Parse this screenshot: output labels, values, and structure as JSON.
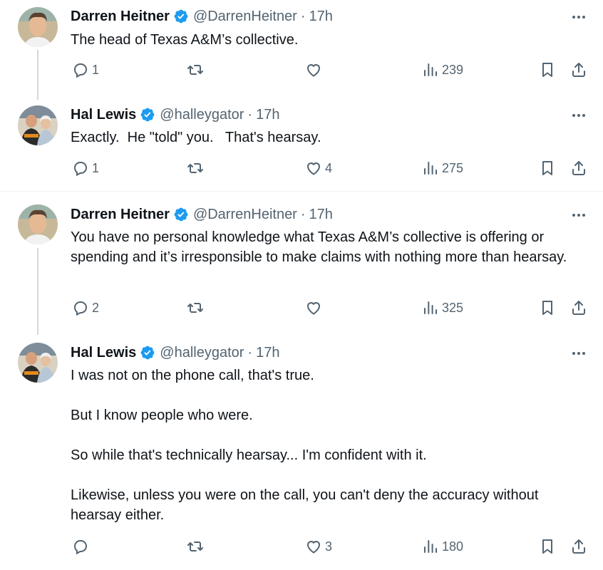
{
  "tweets": [
    {
      "author": "Darren Heitner",
      "handle": "@DarrenHeitner",
      "time": "17h",
      "text": "The head of Texas A&M’s collective.",
      "replies": "1",
      "retweets": "",
      "likes": "",
      "views": "239",
      "avatar": "darren-heitner-avatar"
    },
    {
      "author": "Hal Lewis",
      "handle": "@halleygator",
      "time": "17h",
      "text": "Exactly.  He \"told\" you.   That's hearsay.",
      "replies": "1",
      "retweets": "",
      "likes": "4",
      "views": "275",
      "avatar": "hal-lewis-avatar"
    },
    {
      "author": "Darren Heitner",
      "handle": "@DarrenHeitner",
      "time": "17h",
      "text": "You have no personal knowledge what Texas A&M’s collective is offering or spending and it’s irresponsible to make claims with nothing more than hearsay.",
      "replies": "2",
      "retweets": "",
      "likes": "",
      "views": "325",
      "avatar": "darren-heitner-avatar"
    },
    {
      "author": "Hal Lewis",
      "handle": "@halleygator",
      "time": "17h",
      "text": "I was not on the phone call, that's true.\n\nBut I know people who were.\n\nSo while that's technically hearsay... I'm confident with it.\n\nLikewise, unless you were on the call, you can't deny the accuracy without hearsay either.",
      "replies": "",
      "retweets": "",
      "likes": "3",
      "views": "180",
      "avatar": "hal-lewis-avatar"
    }
  ],
  "separator": "·",
  "colors": {
    "verified": "#1d9bf0",
    "muted": "#536471",
    "text": "#0f1419",
    "thread_line": "#cfd9de"
  }
}
